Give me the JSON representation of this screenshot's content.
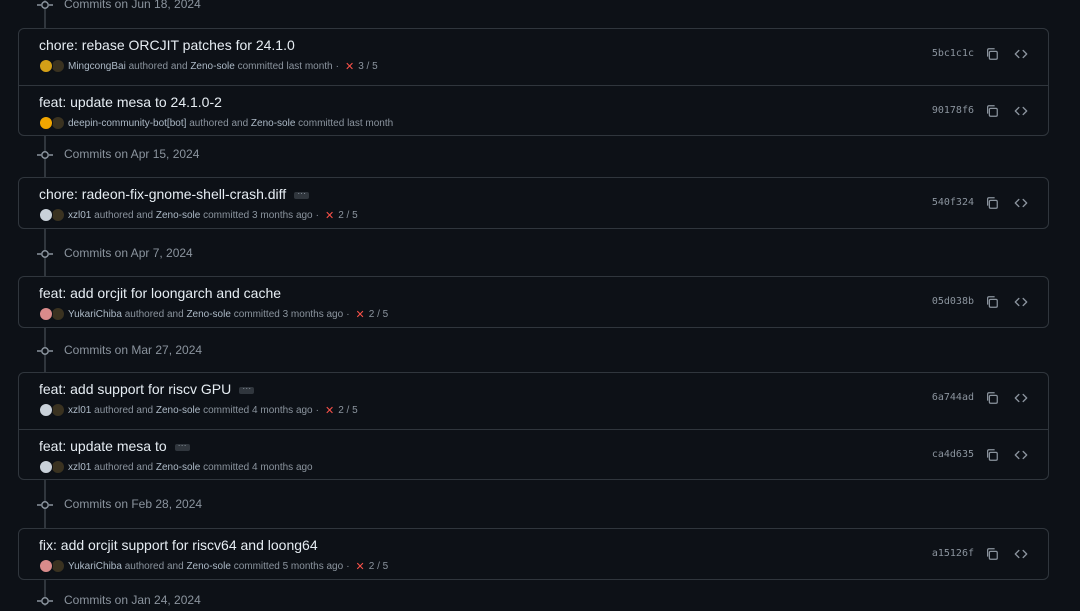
{
  "colors": {
    "background": "#0d1117",
    "border": "#30363d",
    "text": "#e6edf3",
    "muted": "#8b949e",
    "fail": "#f85149"
  },
  "groups": [
    {
      "label": "Commits on Jun 18, 2024",
      "commits": [
        {
          "message": "chore: rebase ORCJIT patches for 24.1.0",
          "has_more": false,
          "author": "MingcongBai",
          "authored_text": "authored and",
          "committer": "Zeno-sole",
          "committed_text": "committed last month",
          "checks": "3 / 5",
          "sha": "5bc1c1c",
          "avatar_color": "#d4a017"
        },
        {
          "message": "feat: update mesa to 24.1.0-2",
          "has_more": false,
          "author": "deepin-community-bot[bot]",
          "authored_text": "authored and",
          "committer": "Zeno-sole",
          "committed_text": "committed last month",
          "checks": "",
          "sha": "90178f6",
          "avatar_color": "#f0a500"
        }
      ]
    },
    {
      "label": "Commits on Apr 15, 2024",
      "commits": [
        {
          "message": "chore: radeon-fix-gnome-shell-crash.diff",
          "has_more": true,
          "author": "xzl01",
          "authored_text": "authored and",
          "committer": "Zeno-sole",
          "committed_text": "committed 3 months ago",
          "checks": "2 / 5",
          "sha": "540f324",
          "avatar_color": "#c9d1d9"
        }
      ]
    },
    {
      "label": "Commits on Apr 7, 2024",
      "commits": [
        {
          "message": "feat: add orcjit for loongarch and cache",
          "has_more": false,
          "author": "YukariChiba",
          "authored_text": "authored and",
          "committer": "Zeno-sole",
          "committed_text": "committed 3 months ago",
          "checks": "2 / 5",
          "sha": "05d038b",
          "avatar_color": "#d98b8b"
        }
      ]
    },
    {
      "label": "Commits on Mar 27, 2024",
      "commits": [
        {
          "message": "feat: add support for riscv GPU",
          "has_more": true,
          "author": "xzl01",
          "authored_text": "authored and",
          "committer": "Zeno-sole",
          "committed_text": "committed 4 months ago",
          "checks": "2 / 5",
          "sha": "6a744ad",
          "avatar_color": "#c9d1d9"
        },
        {
          "message": "feat: update mesa to",
          "has_more": true,
          "author": "xzl01",
          "authored_text": "authored and",
          "committer": "Zeno-sole",
          "committed_text": "committed 4 months ago",
          "checks": "",
          "sha": "ca4d635",
          "avatar_color": "#c9d1d9"
        }
      ]
    },
    {
      "label": "Commits on Feb 28, 2024",
      "commits": [
        {
          "message": "fix: add orcjit support for riscv64 and loong64",
          "has_more": false,
          "author": "YukariChiba",
          "authored_text": "authored and",
          "committer": "Zeno-sole",
          "committed_text": "committed 5 months ago",
          "checks": "2 / 5",
          "sha": "a15126f",
          "avatar_color": "#d98b8b"
        }
      ]
    },
    {
      "label": "Commits on Jan 24, 2024",
      "commits": []
    }
  ]
}
